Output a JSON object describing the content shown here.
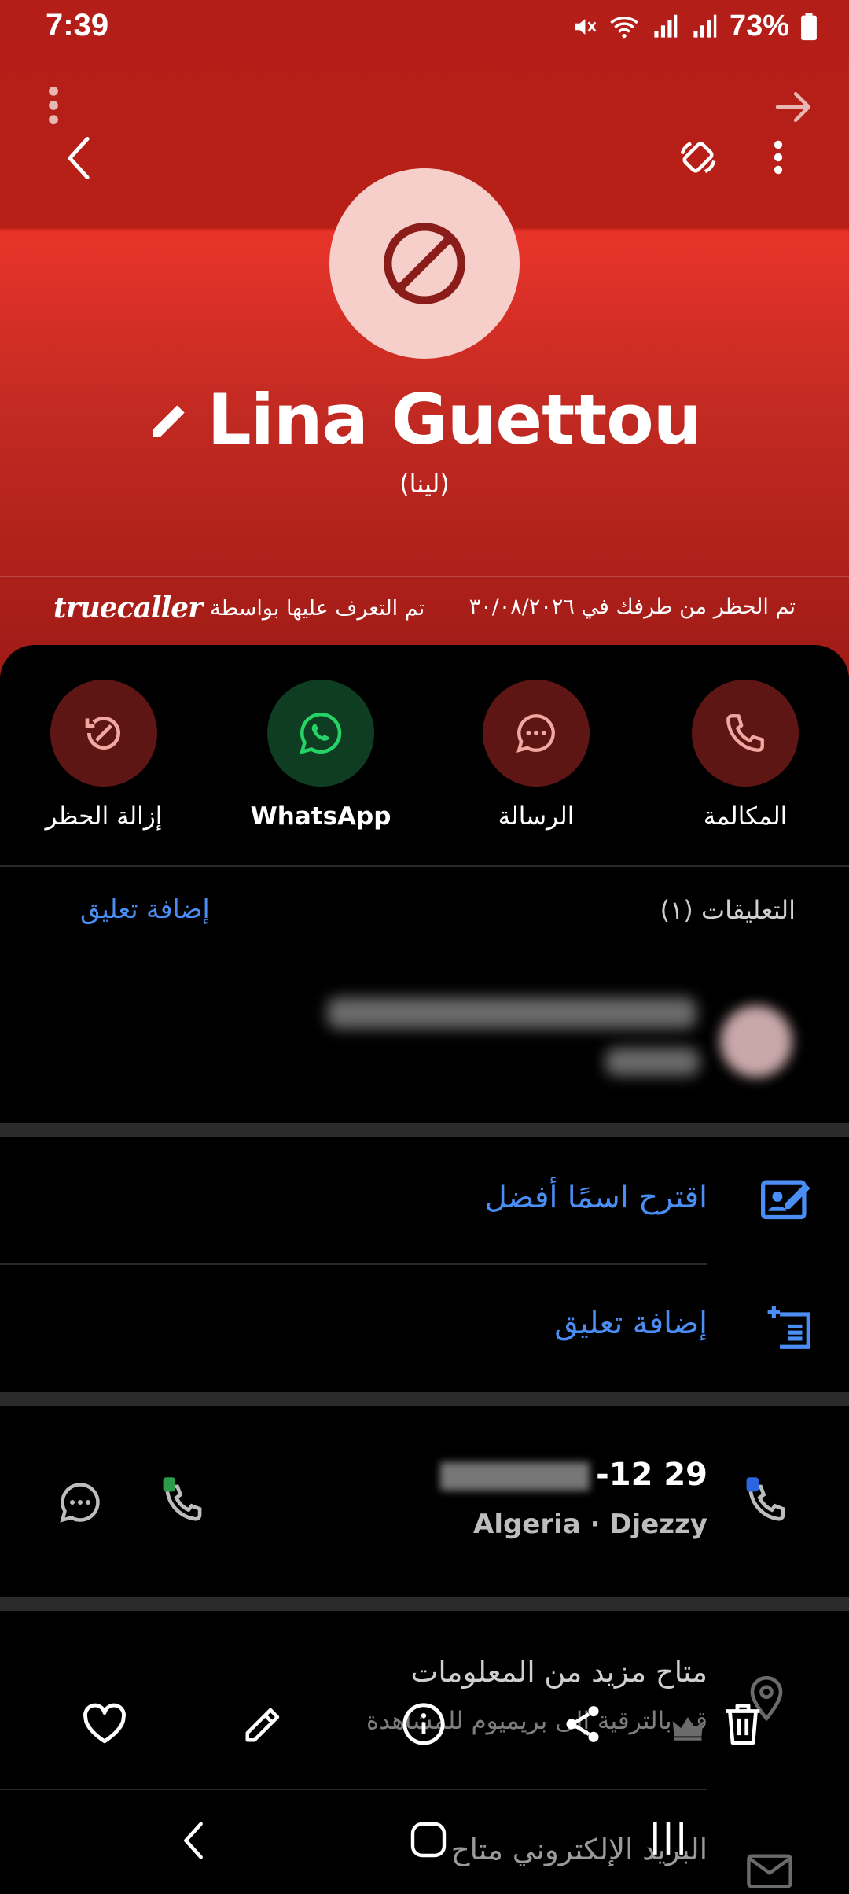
{
  "status_bar": {
    "time": "7:39",
    "battery": "73%"
  },
  "contact": {
    "name": "Lina Guettou",
    "alt_name": "(لينا)",
    "blocked_note": "تم الحظر من طرفك في ٣٠/٠٨/٢٠٢٦",
    "identified_by": "تم التعرف عليها بواسطة",
    "brand": "truecaller"
  },
  "actions": [
    {
      "label": "المكالمة",
      "icon": "phone-icon"
    },
    {
      "label": "الرسالة",
      "icon": "message-icon"
    },
    {
      "label": "WhatsApp",
      "icon": "whatsapp-icon"
    },
    {
      "label": "إزالة الحظر",
      "icon": "unblock-icon"
    }
  ],
  "comments": {
    "title": "التعليقات (١)",
    "add_label": "إضافة تعليق"
  },
  "suggest_name": "اقترح اسمًا أفضل",
  "add_comment": "إضافة تعليق",
  "phone": {
    "number_visible": "-12 29",
    "carrier": "Algeria · Djezzy"
  },
  "more_info": {
    "title": "متاح مزيد من المعلومات",
    "subtitle": "قم بالترقية إلى بريميوم للمشاهدة"
  },
  "email": {
    "title": "البريد الإلكتروني متاح"
  },
  "colors": {
    "header_red": "#c42219",
    "link_blue": "#4a8ef5",
    "whatsapp_green": "#25d366"
  }
}
